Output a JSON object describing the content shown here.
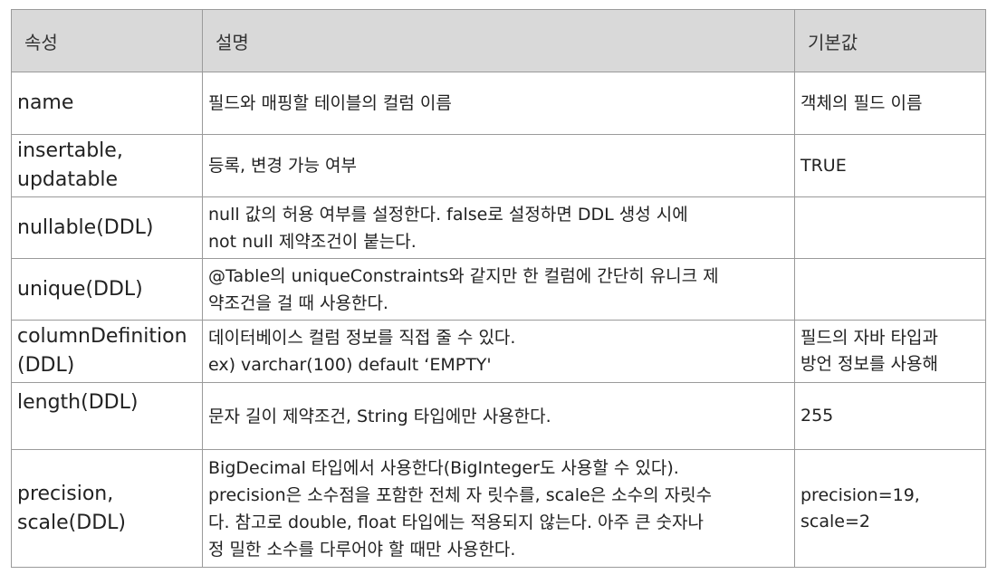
{
  "table": {
    "headers": [
      "속성",
      "설명",
      "기본값"
    ],
    "rows": [
      {
        "attr": [
          "name"
        ],
        "desc": [
          "필드와 매핑할 테이블의 컬럼 이름"
        ],
        "default": [
          "객체의 필드 이름"
        ]
      },
      {
        "attr": [
          "insertable,",
          "updatable"
        ],
        "desc": [
          "등록, 변경 가능 여부"
        ],
        "default": [
          "TRUE"
        ]
      },
      {
        "attr": [
          "nullable(DDL)"
        ],
        "desc": [
          "null 값의 허용 여부를 설정한다. false로 설정하면 DDL 생성 시에",
          "not null 제약조건이 붙는다."
        ],
        "default": []
      },
      {
        "attr": [
          "unique(DDL)"
        ],
        "desc": [
          "@Table의 uniqueConstraints와 같지만 한 컬럼에 간단히 유니크 제",
          "약조건을 걸 때 사용한다."
        ],
        "default": []
      },
      {
        "attr": [
          "columnDefinition",
          "(DDL)"
        ],
        "desc": [
          "데이터베이스 컬럼 정보를 직접 줄 수 있다.",
          "ex) varchar(100) default ‘EMPTY'"
        ],
        "default": [
          "필드의 자바 타입과",
          "방언 정보를 사용해"
        ]
      },
      {
        "attr": [
          "length(DDL)"
        ],
        "desc": [
          "문자 길이 제약조건, String 타입에만 사용한다."
        ],
        "default": [
          "255"
        ]
      },
      {
        "attr": [
          "precision,",
          "scale(DDL)"
        ],
        "desc": [
          "BigDecimal 타입에서 사용한다(BigInteger도 사용할 수 있다).",
          "precision은 소수점을 포함한 전체 자 릿수를, scale은 소수의 자릿수",
          "다. 참고로 double, float 타입에는 적용되지 않는다. 아주 큰 숫자나",
          "정 밀한 소수를 다루어야 할 때만 사용한다."
        ],
        "default": [
          "precision=19,",
          "scale=2"
        ]
      }
    ]
  }
}
